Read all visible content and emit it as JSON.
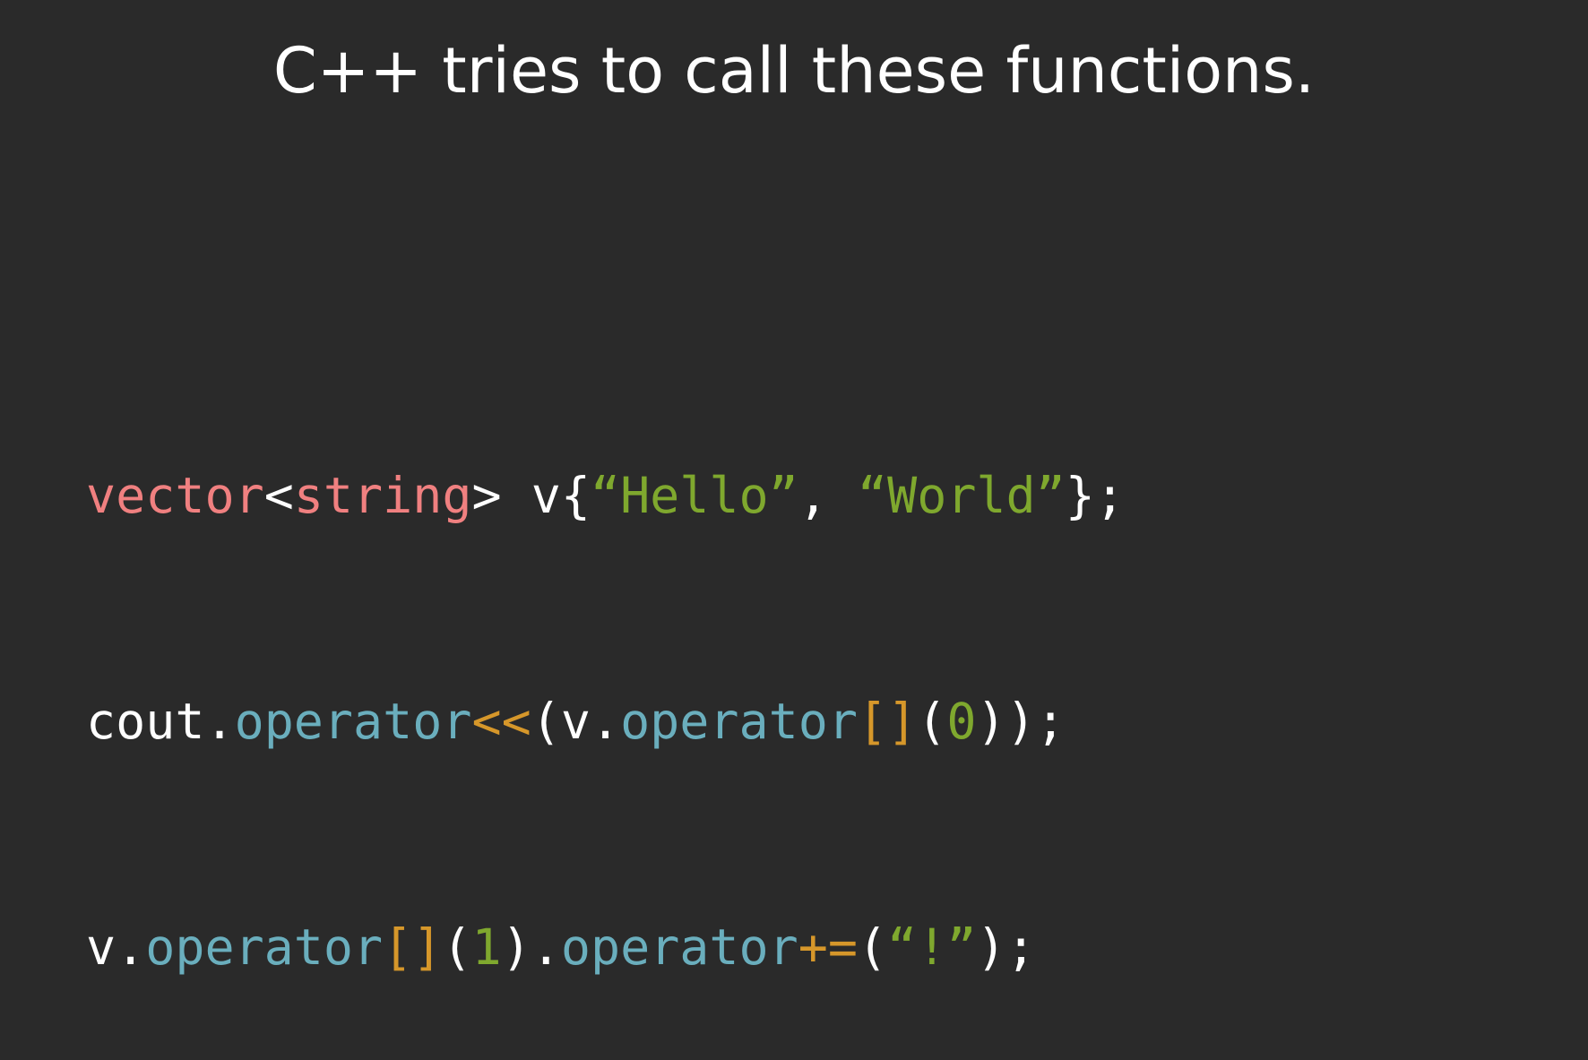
{
  "slide": {
    "title": "C++ tries to call these functions."
  },
  "colors": {
    "background": "#2a2a2a",
    "plain": "#ffffff",
    "type": "#f08080",
    "method": "#6aaebd",
    "operator_symbol": "#d6972a",
    "literal": "#7fa82e"
  },
  "code": {
    "lines": [
      {
        "tokens": [
          {
            "text": "vector",
            "kind": "type"
          },
          {
            "text": "<",
            "kind": "plain"
          },
          {
            "text": "string",
            "kind": "type"
          },
          {
            "text": "> v{",
            "kind": "plain"
          },
          {
            "text": "“Hello”",
            "kind": "literal"
          },
          {
            "text": ", ",
            "kind": "plain"
          },
          {
            "text": "“World”",
            "kind": "literal"
          },
          {
            "text": "};",
            "kind": "plain"
          }
        ]
      },
      {
        "tokens": [
          {
            "text": "cout.",
            "kind": "plain"
          },
          {
            "text": "operator",
            "kind": "method"
          },
          {
            "text": "<<",
            "kind": "operator_symbol"
          },
          {
            "text": "(v.",
            "kind": "plain"
          },
          {
            "text": "operator",
            "kind": "method"
          },
          {
            "text": "[]",
            "kind": "operator_symbol"
          },
          {
            "text": "(",
            "kind": "plain"
          },
          {
            "text": "0",
            "kind": "literal"
          },
          {
            "text": "));",
            "kind": "plain"
          }
        ]
      },
      {
        "tokens": [
          {
            "text": "v.",
            "kind": "plain"
          },
          {
            "text": "operator",
            "kind": "method"
          },
          {
            "text": "[]",
            "kind": "operator_symbol"
          },
          {
            "text": "(",
            "kind": "plain"
          },
          {
            "text": "1",
            "kind": "literal"
          },
          {
            "text": ").",
            "kind": "plain"
          },
          {
            "text": "operator",
            "kind": "method"
          },
          {
            "text": "+=",
            "kind": "operator_symbol"
          },
          {
            "text": "(",
            "kind": "plain"
          },
          {
            "text": "“!”",
            "kind": "literal"
          },
          {
            "text": ");",
            "kind": "plain"
          }
        ]
      }
    ]
  }
}
